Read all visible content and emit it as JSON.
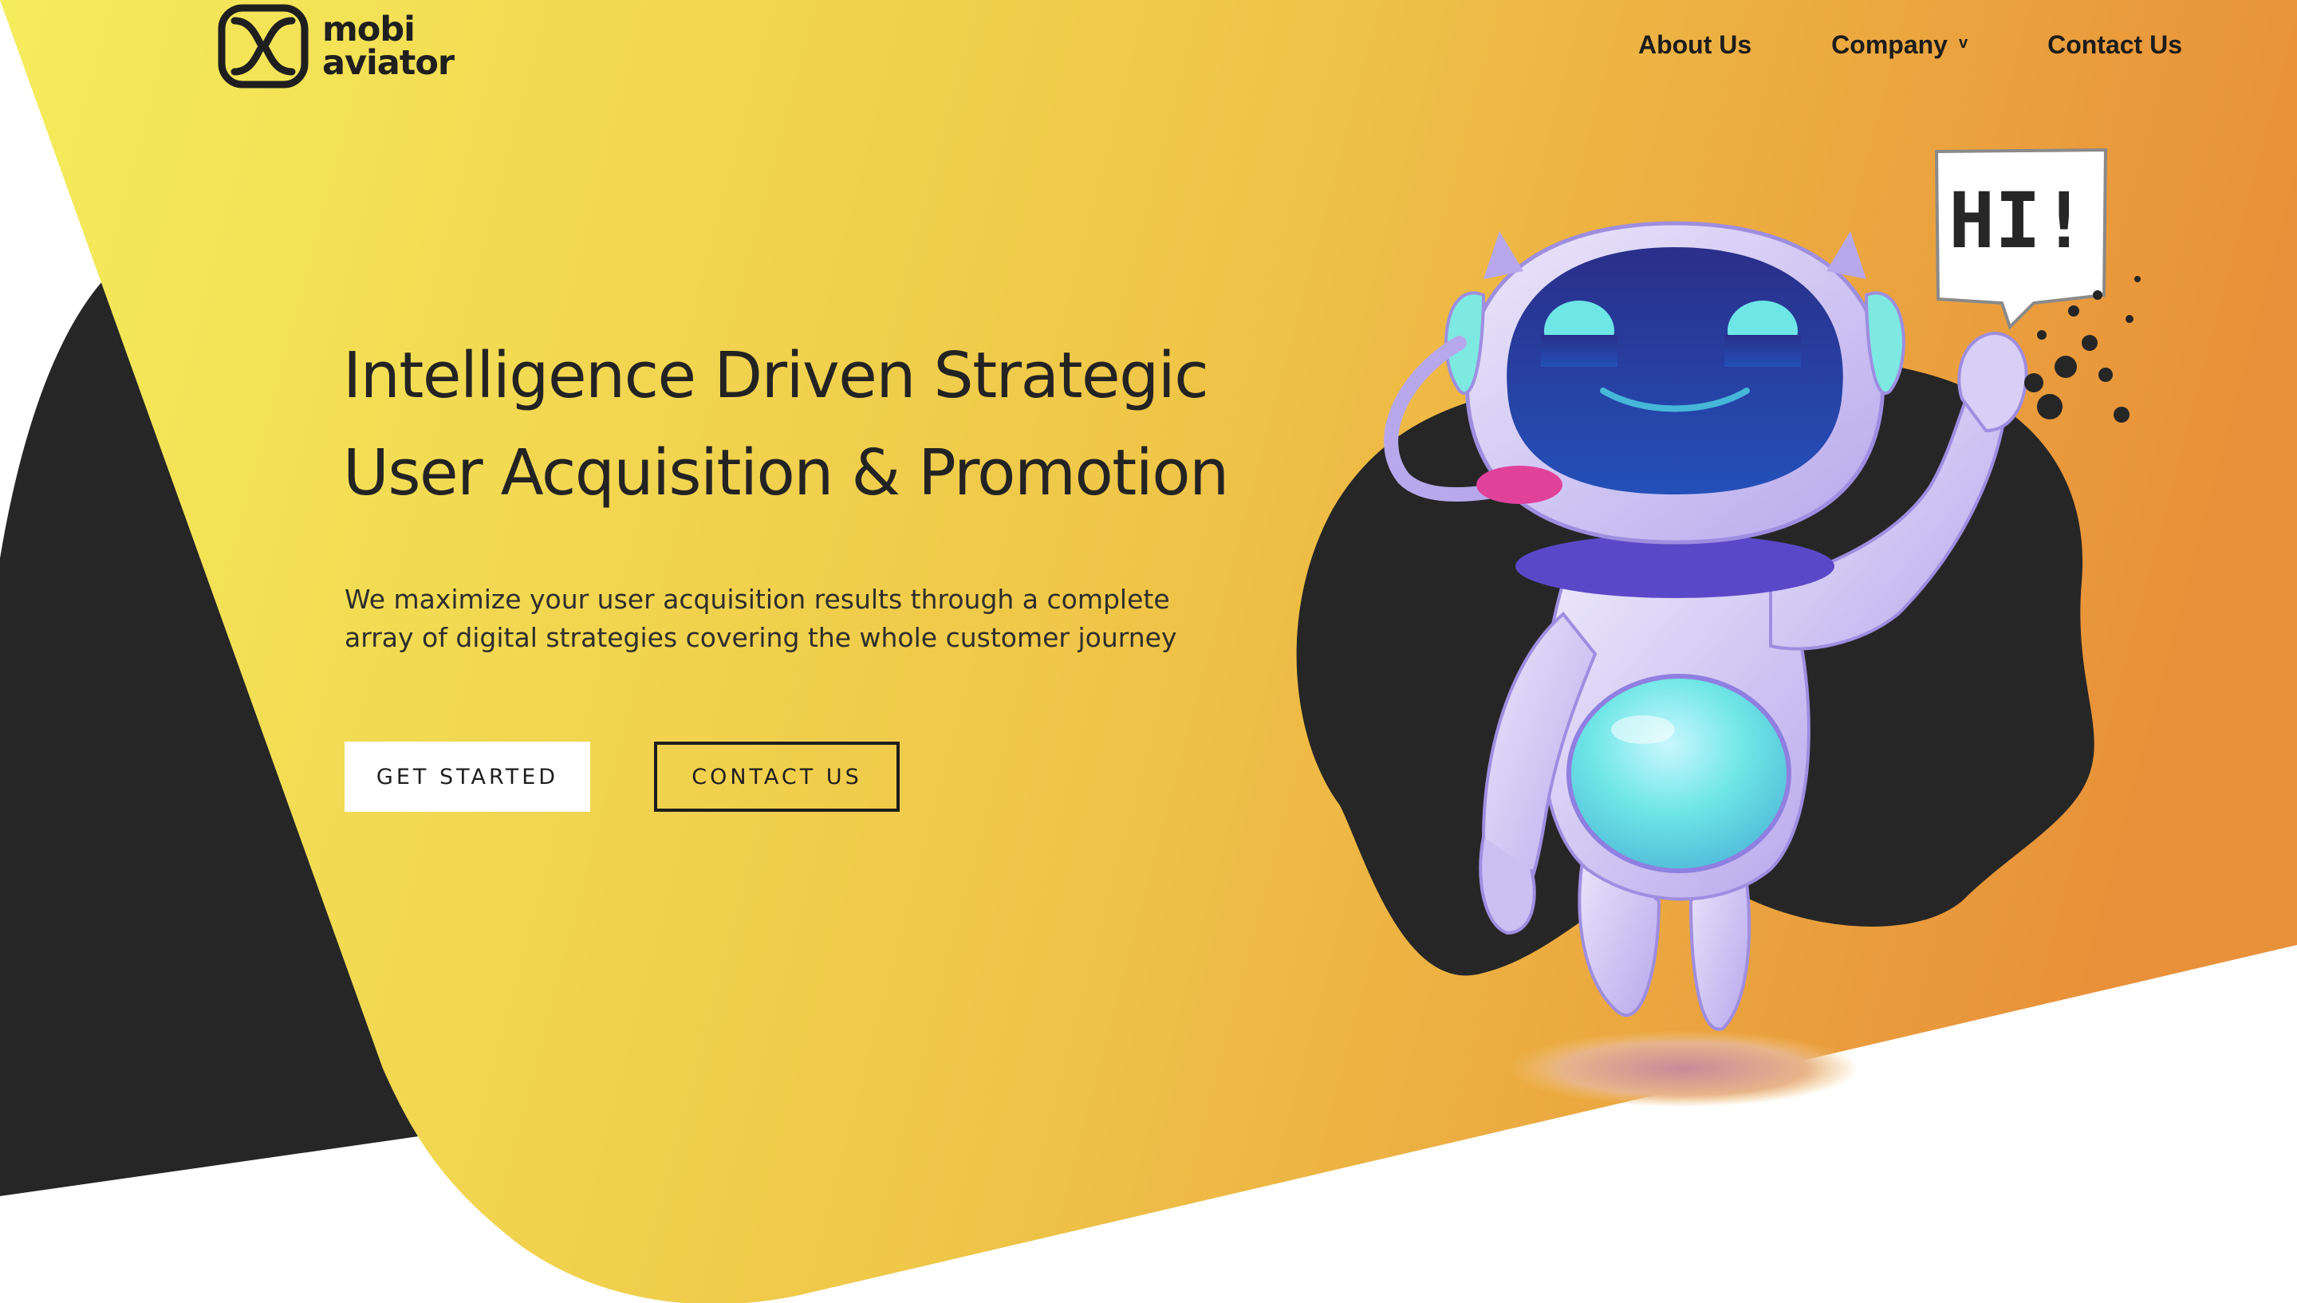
{
  "brand": {
    "name_line1": "mobi",
    "name_line2": "aviator",
    "logo_icon": "infinity-loop-logo"
  },
  "nav": {
    "items": [
      {
        "label": "About Us"
      },
      {
        "label": "Company",
        "caret": "v"
      },
      {
        "label": "Contact Us"
      }
    ]
  },
  "hero": {
    "headline_line1": "Intelligence Driven Strategic",
    "headline_line2": "User Acquisition & Promotion",
    "sub_line1": "We maximize your user acquisition results through a complete",
    "sub_line2": "array of digital strategies covering the whole customer journey",
    "primary_button": "GET STARTED",
    "secondary_button": "CONTACT US"
  },
  "illustration": {
    "speech_bubble": "HI!",
    "subject": "robot-mascot-waving"
  },
  "colors": {
    "gradient_start": "#f5ec5c",
    "gradient_end": "#e8913a",
    "dark": "#262626",
    "text": "#232323"
  }
}
